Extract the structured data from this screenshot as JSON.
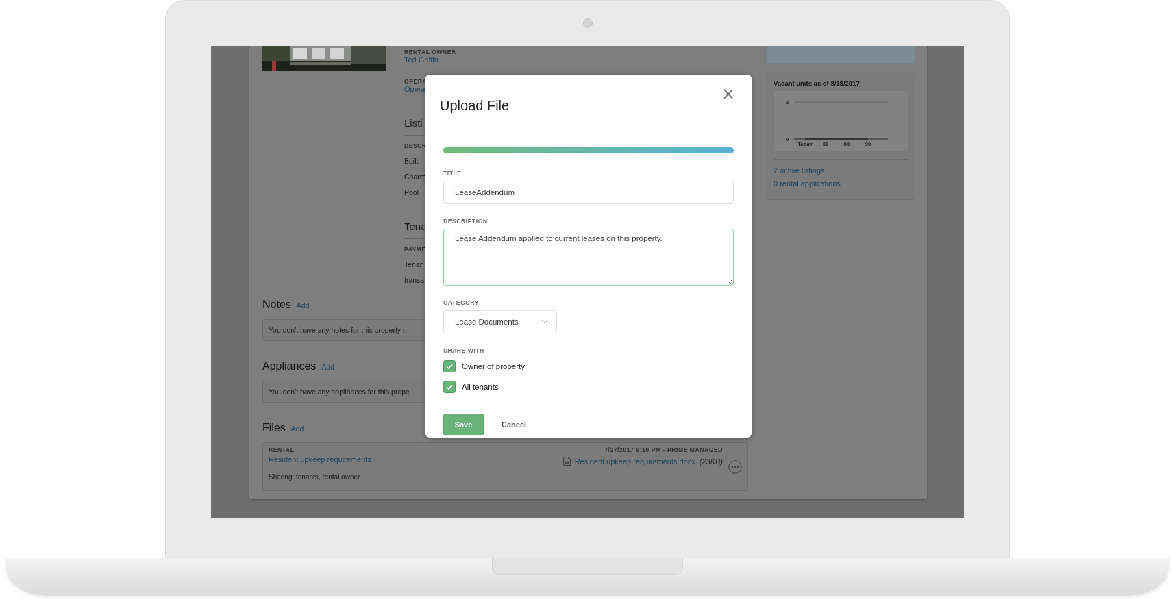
{
  "page": {
    "owner_label": "RENTAL OWNER",
    "owner": "Ted Griffin",
    "operator_label": "OPERA",
    "operator": "Opera",
    "sections": [
      {
        "heading": "Listi",
        "label": "DESCR",
        "lines": [
          "Built i",
          "Charm",
          "Pool"
        ]
      },
      {
        "heading": "Tena",
        "label": "PAYME",
        "lines": [
          "Tenan",
          "transa"
        ]
      }
    ],
    "notes": {
      "heading": "Notes",
      "action": "Add",
      "empty_text": "You don't have any notes for this property ri"
    },
    "appliances": {
      "heading": "Appliances",
      "action": "Add",
      "empty_text": "You don't have any appliances for this prope"
    },
    "files": {
      "heading": "Files",
      "action": "Add",
      "items": [
        {
          "category": "RENTAL",
          "title": "Resident upkeep requirements",
          "sharing": "Sharing: tenants, rental owner",
          "meta": "7/27/2017 6:10 PM - PRIME MANAGED",
          "file_name": "Resident upkeep requirements.docx",
          "size": "(23KB)"
        }
      ]
    }
  },
  "sidebar": {
    "vacancy": {
      "chart_data": {
        "type": "line",
        "title": "Vacant units as of 8/18/2017",
        "categories": [
          "Today",
          "30",
          "60",
          "90"
        ],
        "values": [
          0,
          0,
          0,
          0
        ],
        "ylim": [
          0,
          2
        ],
        "yticks": [
          0,
          2
        ]
      }
    },
    "links": [
      "2 active listings",
      "0 rental applications"
    ]
  },
  "modal": {
    "title": "Upload File",
    "close": "×",
    "progress": {
      "level": 1
    },
    "fields": [
      {
        "kind": "text",
        "label": "TITLE",
        "value": "LeaseAddendum",
        "focused": false
      },
      {
        "kind": "textarea",
        "label": "DESCRIPTION",
        "value": "Lease Addendum applied to current leases on this property.",
        "focused": true
      },
      {
        "kind": "select",
        "label": "CATEGORY",
        "value": "Lease Documents",
        "focused": false
      }
    ],
    "share_with": {
      "label": "SHARE WITH",
      "options": [
        {
          "label": "Owner of property",
          "checked": true
        },
        {
          "label": "All tenants",
          "checked": true
        }
      ]
    },
    "buttons": [
      {
        "kind": "primary",
        "label": "Save"
      },
      {
        "kind": "link",
        "label": "Cancel"
      }
    ]
  }
}
